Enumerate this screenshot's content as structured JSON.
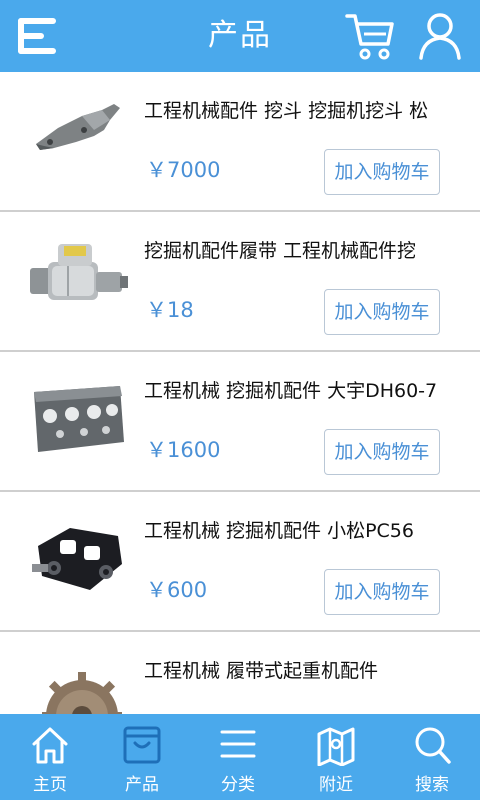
{
  "header": {
    "title": "产品",
    "menu_icon": "menu-icon",
    "cart_icon": "cart-icon",
    "user_icon": "user-icon"
  },
  "products": [
    {
      "name": "工程机械配件 挖斗 挖掘机挖斗 松",
      "price": "￥7000",
      "button": "加入购物车",
      "image": "metal-bracket"
    },
    {
      "name": "挖掘机配件履带 工程机械配件挖",
      "price": "￥18",
      "button": "加入购物车",
      "image": "starter-motor"
    },
    {
      "name": "工程机械 挖掘机配件 大宇DH60-7",
      "price": "￥1600",
      "button": "加入购物车",
      "image": "cylinder-head"
    },
    {
      "name": "工程机械 挖掘机配件 小松PC56",
      "price": "￥600",
      "button": "加入购物车",
      "image": "track-link"
    },
    {
      "name": "工程机械 履带式起重机配件",
      "price": "",
      "button": "",
      "image": "gear"
    }
  ],
  "tabs": [
    {
      "label": "主页",
      "icon": "home-icon"
    },
    {
      "label": "产品",
      "icon": "product-icon"
    },
    {
      "label": "分类",
      "icon": "category-icon"
    },
    {
      "label": "附近",
      "icon": "map-icon"
    },
    {
      "label": "搜索",
      "icon": "search-icon"
    }
  ],
  "colors": {
    "accent": "#4aa9ec",
    "price": "#4a90d6",
    "divider": "#cfcfcf"
  }
}
